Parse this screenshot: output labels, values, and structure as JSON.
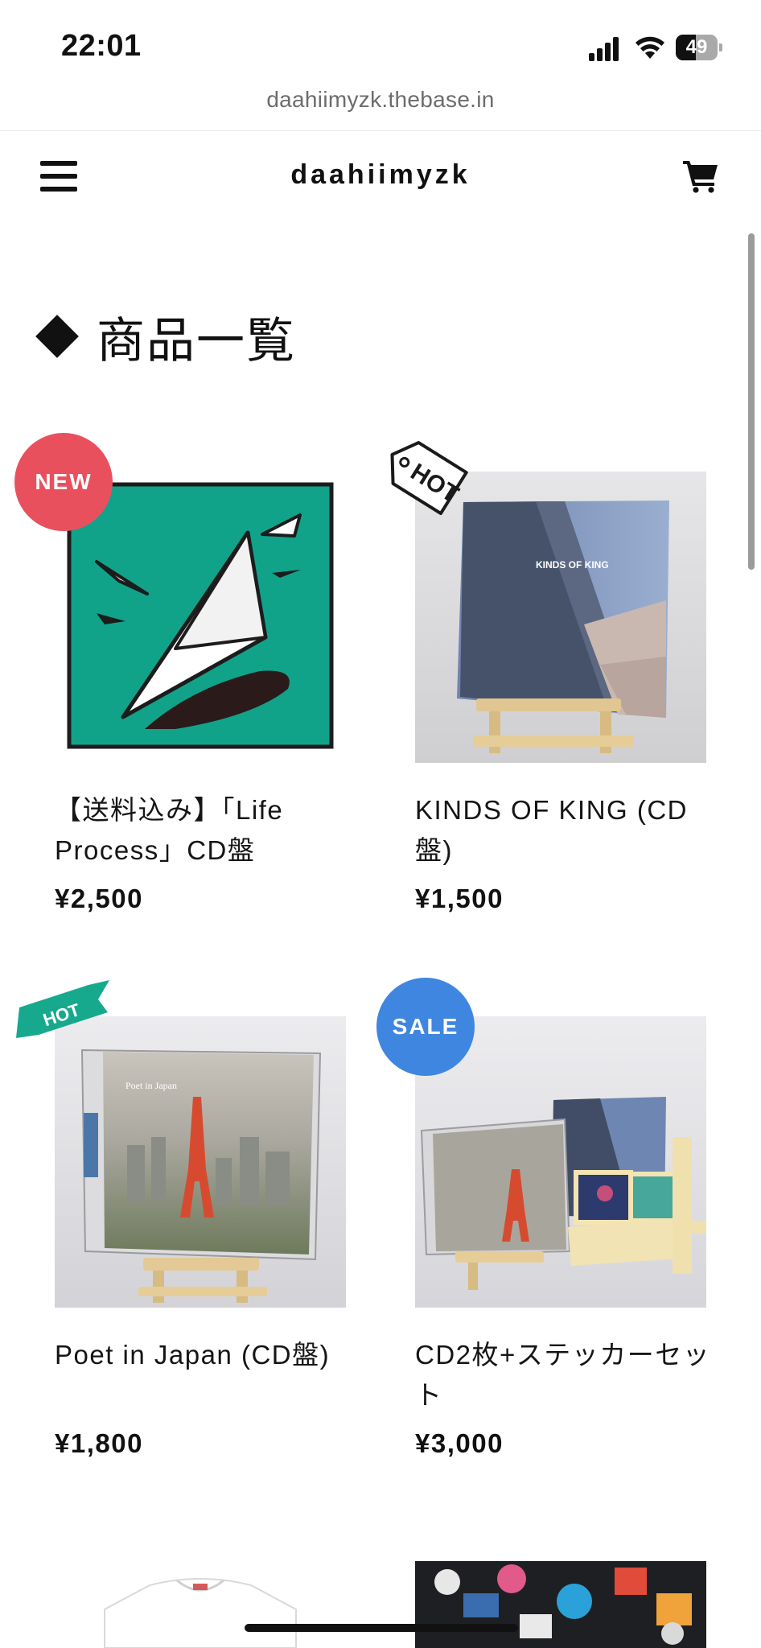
{
  "status_bar": {
    "time": "22:01",
    "battery": "49",
    "battery_level": 0.49
  },
  "browser": {
    "url": "daahiimyzk.thebase.in"
  },
  "header": {
    "shop_name": "daahiimyzk"
  },
  "section": {
    "title": "商品一覧"
  },
  "products": [
    {
      "title": "【送料込み】「Life Process」CD盤",
      "price": "¥2,500",
      "badge": "NEW",
      "badge_color": "#e9505e"
    },
    {
      "title": "KINDS OF KING (CD盤)",
      "price": "¥1,500",
      "badge": "HOT",
      "image_text": "KINDS OF KING"
    },
    {
      "title": "Poet in Japan (CD盤)",
      "price": "¥1,800",
      "badge": "HOT",
      "badge_color": "#16a98e",
      "image_text": "Poet in Japan"
    },
    {
      "title": "CD2枚+ステッカーセット",
      "price": "¥3,000",
      "badge": "SALE",
      "badge_color": "#3f86e0"
    }
  ],
  "colors": {
    "accent_teal": "#11a28a",
    "sale_blue": "#3f86e0",
    "new_red": "#e9505e"
  }
}
